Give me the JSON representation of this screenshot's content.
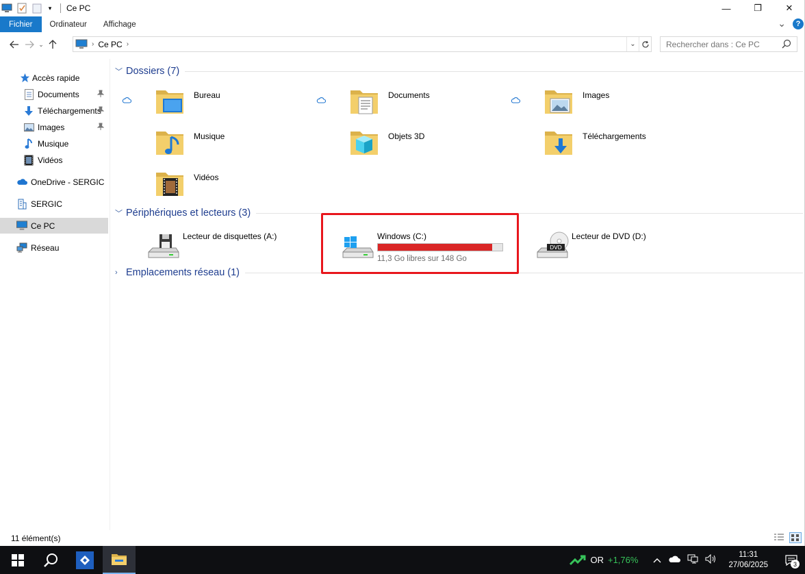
{
  "window": {
    "title": "Ce PC",
    "minimize_glyph": "—",
    "maximize_glyph": "❐",
    "close_glyph": "✕"
  },
  "ribbon": {
    "tabs": [
      "Fichier",
      "Ordinateur",
      "Affichage"
    ],
    "expand_glyph": "⌄",
    "help_glyph": "?"
  },
  "address": {
    "crumbs": [
      "Ce PC"
    ],
    "search_placeholder": "Rechercher dans : Ce PC"
  },
  "nav_pane": {
    "items": [
      {
        "label": "Accès rapide",
        "icon": "star-icon",
        "pinned": false
      },
      {
        "label": "Documents",
        "icon": "documents-icon",
        "pinned": true
      },
      {
        "label": "Téléchargements",
        "icon": "download-icon",
        "pinned": true
      },
      {
        "label": "Images",
        "icon": "images-icon",
        "pinned": true
      },
      {
        "label": "Musique",
        "icon": "music-icon",
        "pinned": false
      },
      {
        "label": "Vidéos",
        "icon": "videos-icon",
        "pinned": false
      },
      {
        "label": "OneDrive - SERGIC",
        "icon": "cloud-icon",
        "pinned": false
      },
      {
        "label": "SERGIC",
        "icon": "building-icon",
        "pinned": false
      },
      {
        "label": "Ce PC",
        "icon": "computer-icon",
        "pinned": false,
        "selected": true
      },
      {
        "label": "Réseau",
        "icon": "network-icon",
        "pinned": false
      }
    ]
  },
  "groups": {
    "folders": {
      "title": "Dossiers (7)",
      "items": [
        {
          "label": "Bureau",
          "icon": "desktop-folder-icon",
          "cloud": true
        },
        {
          "label": "Documents",
          "icon": "documents-folder-icon",
          "cloud": true
        },
        {
          "label": "Images",
          "icon": "images-folder-icon",
          "cloud": true
        },
        {
          "label": "Musique",
          "icon": "music-folder-icon",
          "cloud": false
        },
        {
          "label": "Objets 3D",
          "icon": "3d-objects-folder-icon",
          "cloud": false
        },
        {
          "label": "Téléchargements",
          "icon": "downloads-folder-icon",
          "cloud": false
        },
        {
          "label": "Vidéos",
          "icon": "videos-folder-icon",
          "cloud": false
        }
      ]
    },
    "devices": {
      "title": "Périphériques et lecteurs (3)",
      "items": [
        {
          "label": "Lecteur de disquettes (A:)",
          "icon": "floppy-drive-icon"
        },
        {
          "label": "Windows (C:)",
          "icon": "system-drive-icon",
          "usage": 0.92,
          "free_text": "11,3 Go libres sur 148 Go",
          "bar_color": "#da2626"
        },
        {
          "label": "Lecteur de DVD (D:)",
          "icon": "dvd-drive-icon"
        }
      ]
    },
    "network": {
      "title": "Emplacements réseau (1)"
    }
  },
  "status": {
    "count": "11 élément(s)"
  },
  "taskbar": {
    "stock_name": "OR",
    "stock_change": "+1,76%",
    "time": "11:31",
    "date": "27/06/2025",
    "notif_count": "3"
  }
}
